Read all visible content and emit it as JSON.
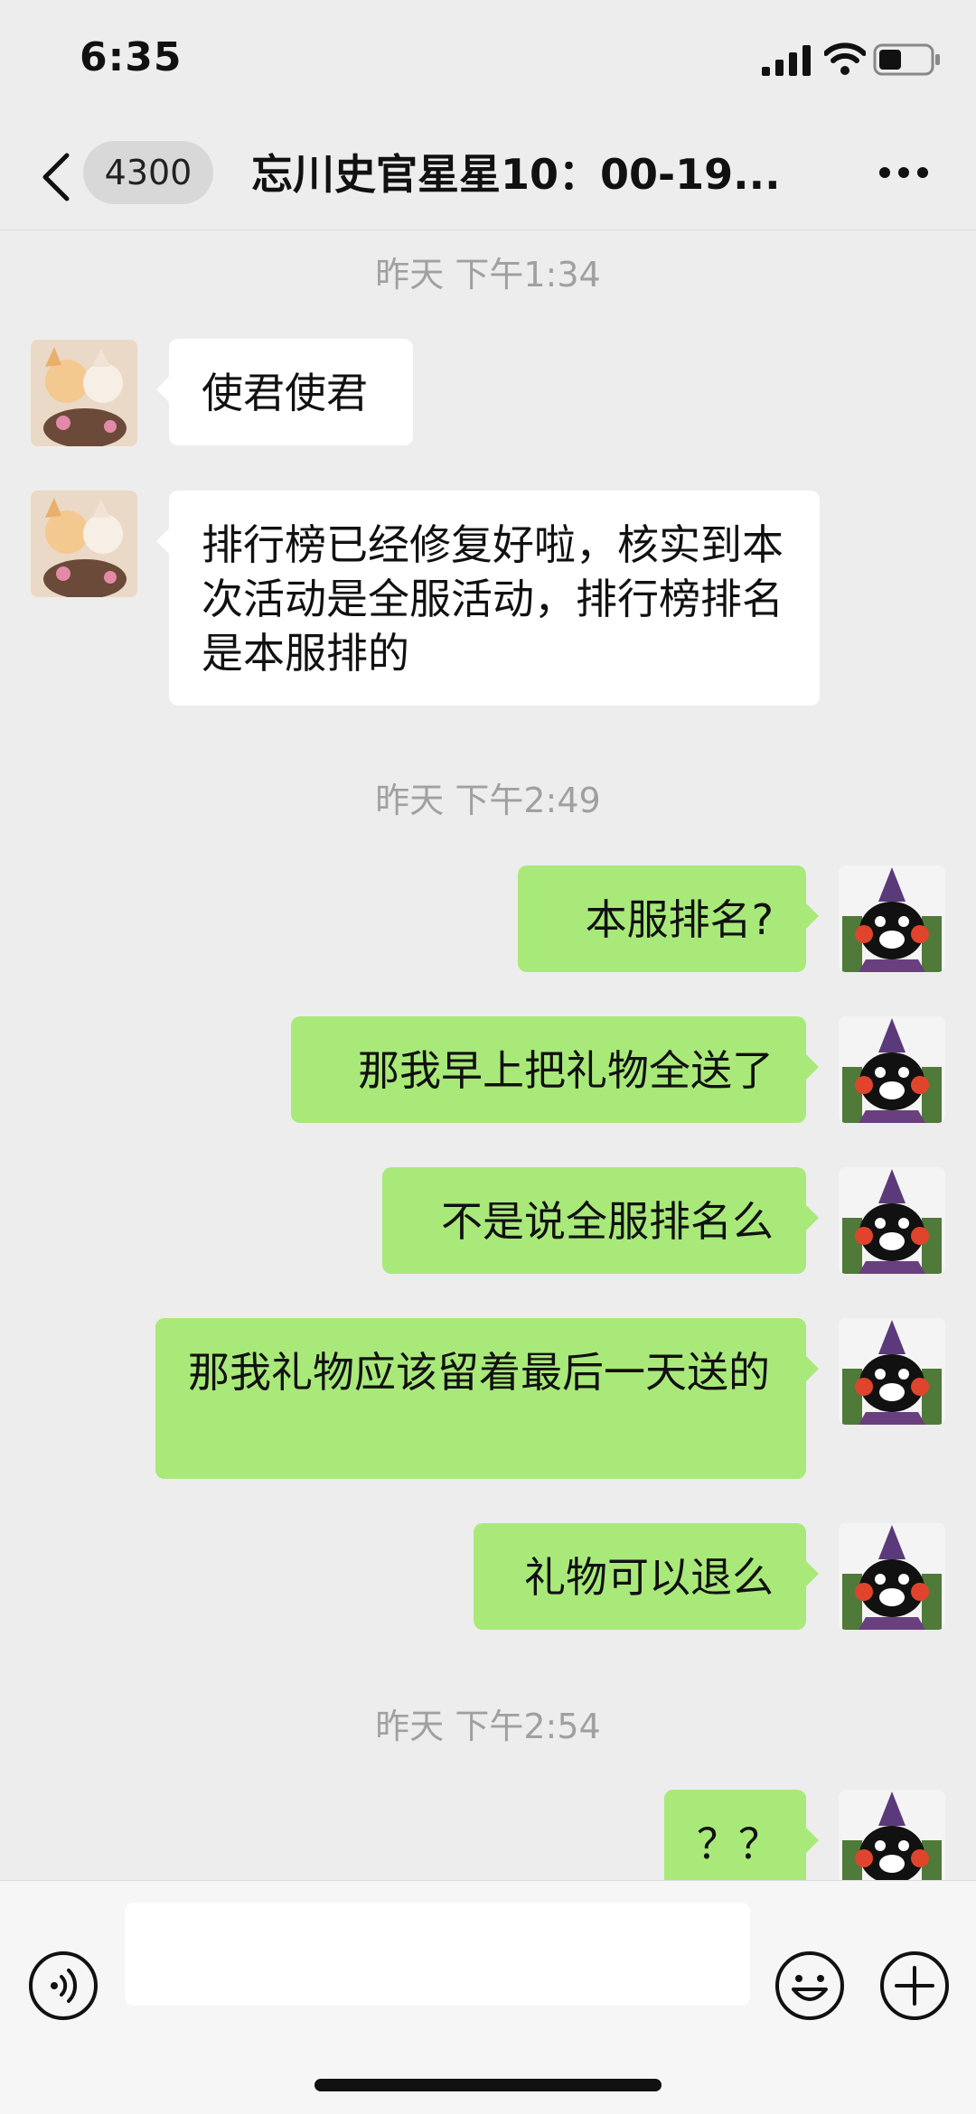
{
  "status_bar": {
    "time": "6:35"
  },
  "nav": {
    "unread_count": "4300",
    "title": "忘川史官星星10：00-19..."
  },
  "messages": [
    {
      "type": "time",
      "text": "昨天 下午1:34"
    },
    {
      "type": "msg",
      "side": "left",
      "text": "使君使君"
    },
    {
      "type": "msg",
      "side": "left",
      "text": "排行榜已经修复好啦，核实到本次活动是全服活动，排行榜排名是本服排的"
    },
    {
      "type": "time",
      "text": "昨天 下午2:49"
    },
    {
      "type": "msg",
      "side": "right",
      "text": "本服排名?"
    },
    {
      "type": "msg",
      "side": "right",
      "text": "那我早上把礼物全送了"
    },
    {
      "type": "msg",
      "side": "right",
      "text": "不是说全服排名么"
    },
    {
      "type": "msg",
      "side": "right",
      "text": "那我礼物应该留着最后一天送的"
    },
    {
      "type": "msg",
      "side": "right",
      "text": "礼物可以退么"
    },
    {
      "type": "time",
      "text": "昨天 下午2:54"
    },
    {
      "type": "msg",
      "side": "right",
      "text": "？？"
    }
  ],
  "icons": {
    "back": "chevron-left-icon",
    "more": "more-dots-icon",
    "voice": "voice-icon",
    "emoji": "emoji-icon",
    "plus": "plus-icon"
  },
  "colors": {
    "sent_bubble": "#a9e97a",
    "received_bubble": "#ffffff",
    "background": "#ededed"
  }
}
